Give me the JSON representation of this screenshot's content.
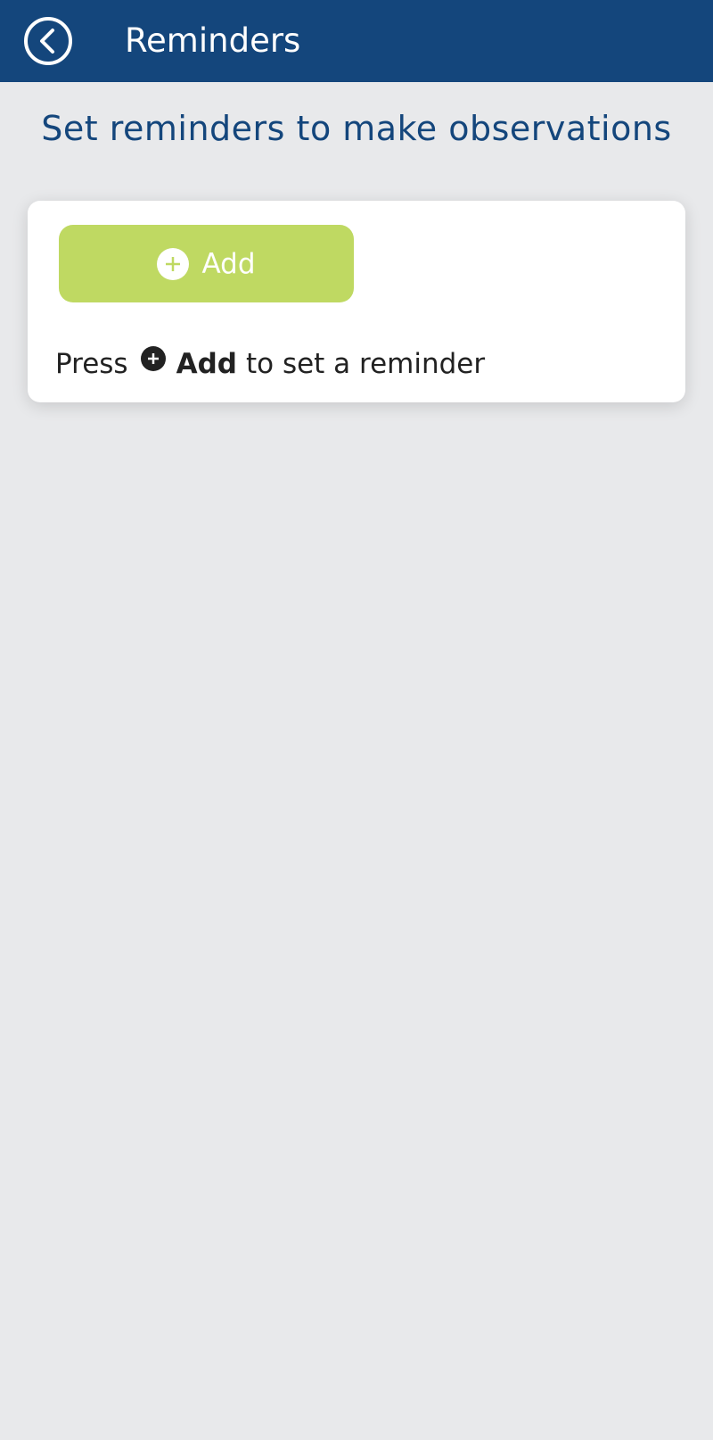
{
  "header": {
    "title": "Reminders",
    "back_icon": "chevron-left-icon"
  },
  "main": {
    "heading": "Set reminders to make observations",
    "add_button": {
      "label": "Add",
      "icon": "plus-circle-icon"
    },
    "hint": {
      "prefix": "Press",
      "icon": "plus-circle-icon",
      "bold": "Add",
      "suffix": "to set a reminder"
    }
  },
  "colors": {
    "header_bg": "#14467c",
    "page_bg": "#e8e9eb",
    "accent_green": "#bfd962",
    "heading_text": "#14467c"
  }
}
